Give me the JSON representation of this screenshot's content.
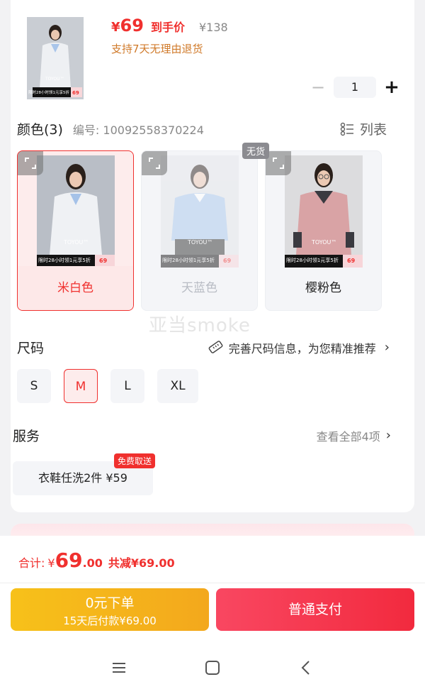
{
  "product": {
    "price_symbol": "¥",
    "price": "69",
    "price_tag": "到手价",
    "original_price": "¥138",
    "return_note": "支持7天无理由退货",
    "quantity": "1",
    "thumb_brand": "TOYOU™",
    "thumb_promo": "限时28小时领1元享5折",
    "thumb_price": "69"
  },
  "color": {
    "title": "颜色(3)",
    "sku_code": "编号: 10092558370224",
    "list_label": "列表",
    "sold_out_badge": "无货",
    "options": [
      {
        "label": "米白色",
        "brand": "TOYOU™",
        "promo": "限时28小时领1元享5折",
        "price": "69"
      },
      {
        "label": "天蓝色",
        "brand": "TOYOU™",
        "promo": "限时28小时领1元享5折",
        "price": "69"
      },
      {
        "label": "樱粉色",
        "brand": "TOYOU™",
        "promo": "限时28小时领1元享5折",
        "price": "69"
      }
    ]
  },
  "size": {
    "title": "尺码",
    "recommend": "完善尺码信息，为您精准推荐",
    "options": [
      "S",
      "M",
      "L",
      "XL"
    ]
  },
  "service": {
    "title": "服务",
    "see_all": "查看全部4项",
    "item": "衣鞋任洗2件  ¥59",
    "badge": "免费取送"
  },
  "watermark": "亚当smoke",
  "footer": {
    "total_label": "合计:",
    "total_symbol": "¥",
    "total_int": "69",
    "total_dec": ".00",
    "saving": "共减¥69.00",
    "zero_line1": "0元下单",
    "zero_line2": "15天后付款¥69.00",
    "pay_label": "普通支付"
  },
  "colors": {
    "accent_red": "#f0302e",
    "gold": "#f3b01b",
    "pink_button": "#f22a3e"
  }
}
